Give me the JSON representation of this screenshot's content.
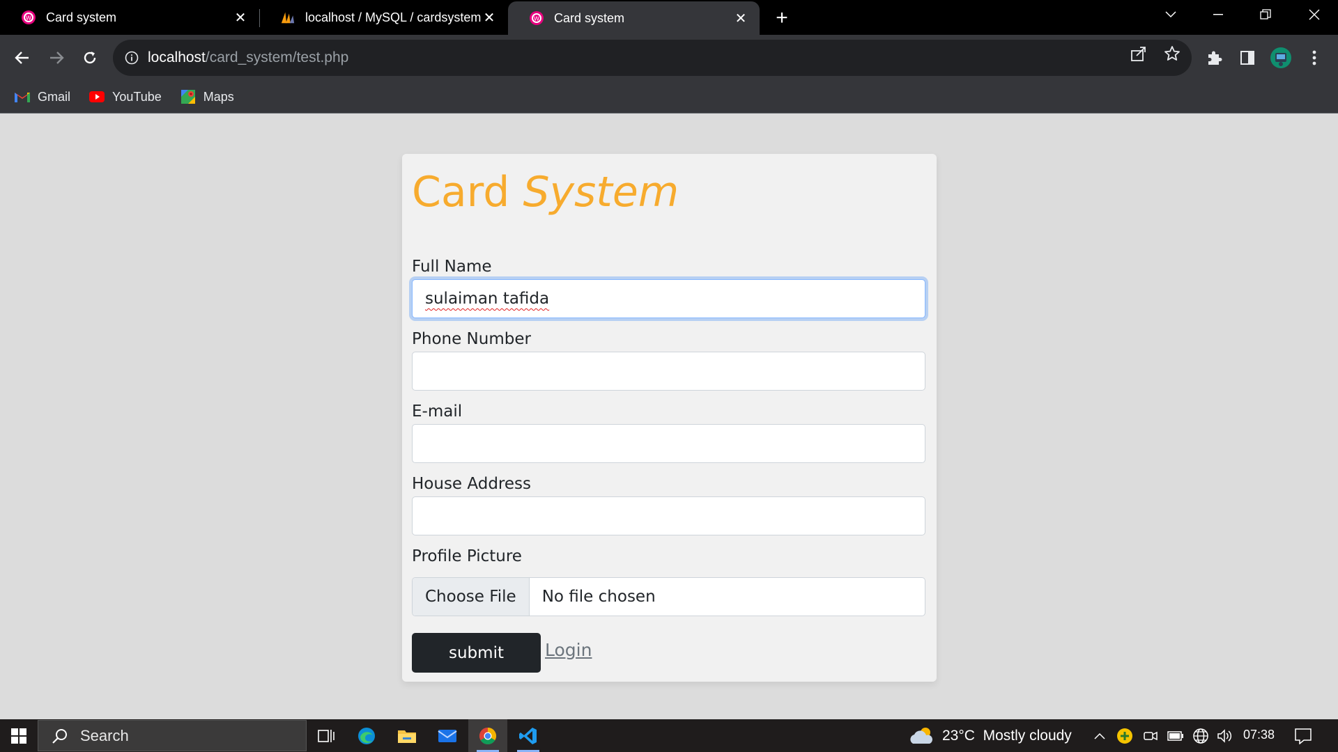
{
  "browser": {
    "tabs": [
      {
        "title": "Card system",
        "favicon": "wamp-icon",
        "active": false
      },
      {
        "title": "localhost / MySQL / cardsystem",
        "favicon": "phpmyadmin-icon",
        "active": false
      },
      {
        "title": "Card system",
        "favicon": "wamp-icon",
        "active": true
      }
    ],
    "new_tab_label": "+",
    "url_host": "localhost",
    "url_path": "/card_system/test.php",
    "bookmarks": [
      {
        "label": "Gmail",
        "icon": "gmail-icon"
      },
      {
        "label": "YouTube",
        "icon": "youtube-icon"
      },
      {
        "label": "Maps",
        "icon": "maps-icon"
      }
    ]
  },
  "page": {
    "brand_plain": "Card",
    "brand_italic": "System",
    "brand_color": "#f7ab2e",
    "fields": [
      {
        "label": "Full Name",
        "value": "sulaiman tafida",
        "focused": true
      },
      {
        "label": "Phone Number",
        "value": ""
      },
      {
        "label": "E-mail",
        "value": ""
      },
      {
        "label": "House Address",
        "value": ""
      }
    ],
    "profile_label": "Profile Picture",
    "choose_file_label": "Choose File",
    "no_file_label": "No file chosen",
    "submit_label": "submit",
    "login_label": "Login"
  },
  "taskbar": {
    "search_placeholder": "Search",
    "weather_temp": "23°C",
    "weather_text": "Mostly cloudy",
    "time": "07:38"
  }
}
